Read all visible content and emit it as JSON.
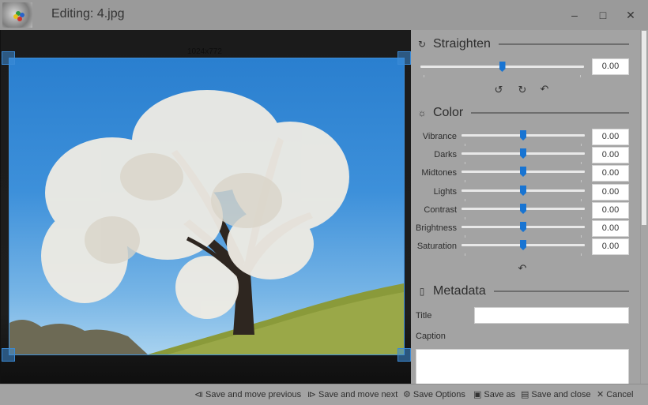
{
  "window": {
    "title": "Editing: 4.jpg",
    "controls": {
      "minimize": "–",
      "maximize": "□",
      "close": "✕"
    }
  },
  "canvas": {
    "image_dimensions": "1024x772"
  },
  "panel": {
    "straighten": {
      "title": "Straighten",
      "icon": "rotate-icon",
      "value": "0.00",
      "slider_fraction": 0.5,
      "buttons": [
        {
          "name": "rotate-left-button",
          "glyph": "↺"
        },
        {
          "name": "rotate-right-button",
          "glyph": "↻"
        },
        {
          "name": "reset-straighten-button",
          "glyph": "↶"
        }
      ]
    },
    "color": {
      "title": "Color",
      "icon": "sun-icon",
      "icon_glyph": "☼",
      "rows": [
        {
          "label": "Vibrance",
          "value": "0.00",
          "slider_fraction": 0.5
        },
        {
          "label": "Darks",
          "value": "0.00",
          "slider_fraction": 0.5
        },
        {
          "label": "Midtones",
          "value": "0.00",
          "slider_fraction": 0.5
        },
        {
          "label": "Lights",
          "value": "0.00",
          "slider_fraction": 0.5
        },
        {
          "label": "Contrast",
          "value": "0.00",
          "slider_fraction": 0.5
        },
        {
          "label": "Brightness",
          "value": "0.00",
          "slider_fraction": 0.5
        },
        {
          "label": "Saturation",
          "value": "0.00",
          "slider_fraction": 0.5
        }
      ],
      "reset_glyph": "↶"
    },
    "metadata": {
      "title": "Metadata",
      "icon": "document-icon",
      "title_label": "Title",
      "title_value": "",
      "caption_label": "Caption",
      "caption_value": ""
    }
  },
  "bottombar": {
    "buttons": [
      {
        "name": "save-and-move-previous-button",
        "icon": "⧏",
        "label": "Save and move previous"
      },
      {
        "name": "save-and-move-next-button",
        "icon": "⧐",
        "label": "Save and move next"
      },
      {
        "name": "save-options-button",
        "icon": "⚙",
        "label": "Save Options"
      },
      {
        "name": "save-as-button",
        "icon": "🖨",
        "label": "Save as"
      },
      {
        "name": "save-and-close-button",
        "icon": "💾",
        "label": "Save and close"
      },
      {
        "name": "cancel-button",
        "icon": "✕",
        "label": "Cancel"
      }
    ]
  },
  "colors": {
    "accent": "#1874d2",
    "titlebar": "#9a9a9a",
    "panel": "#a3a3a3",
    "canvas": "#1b1b1b"
  }
}
